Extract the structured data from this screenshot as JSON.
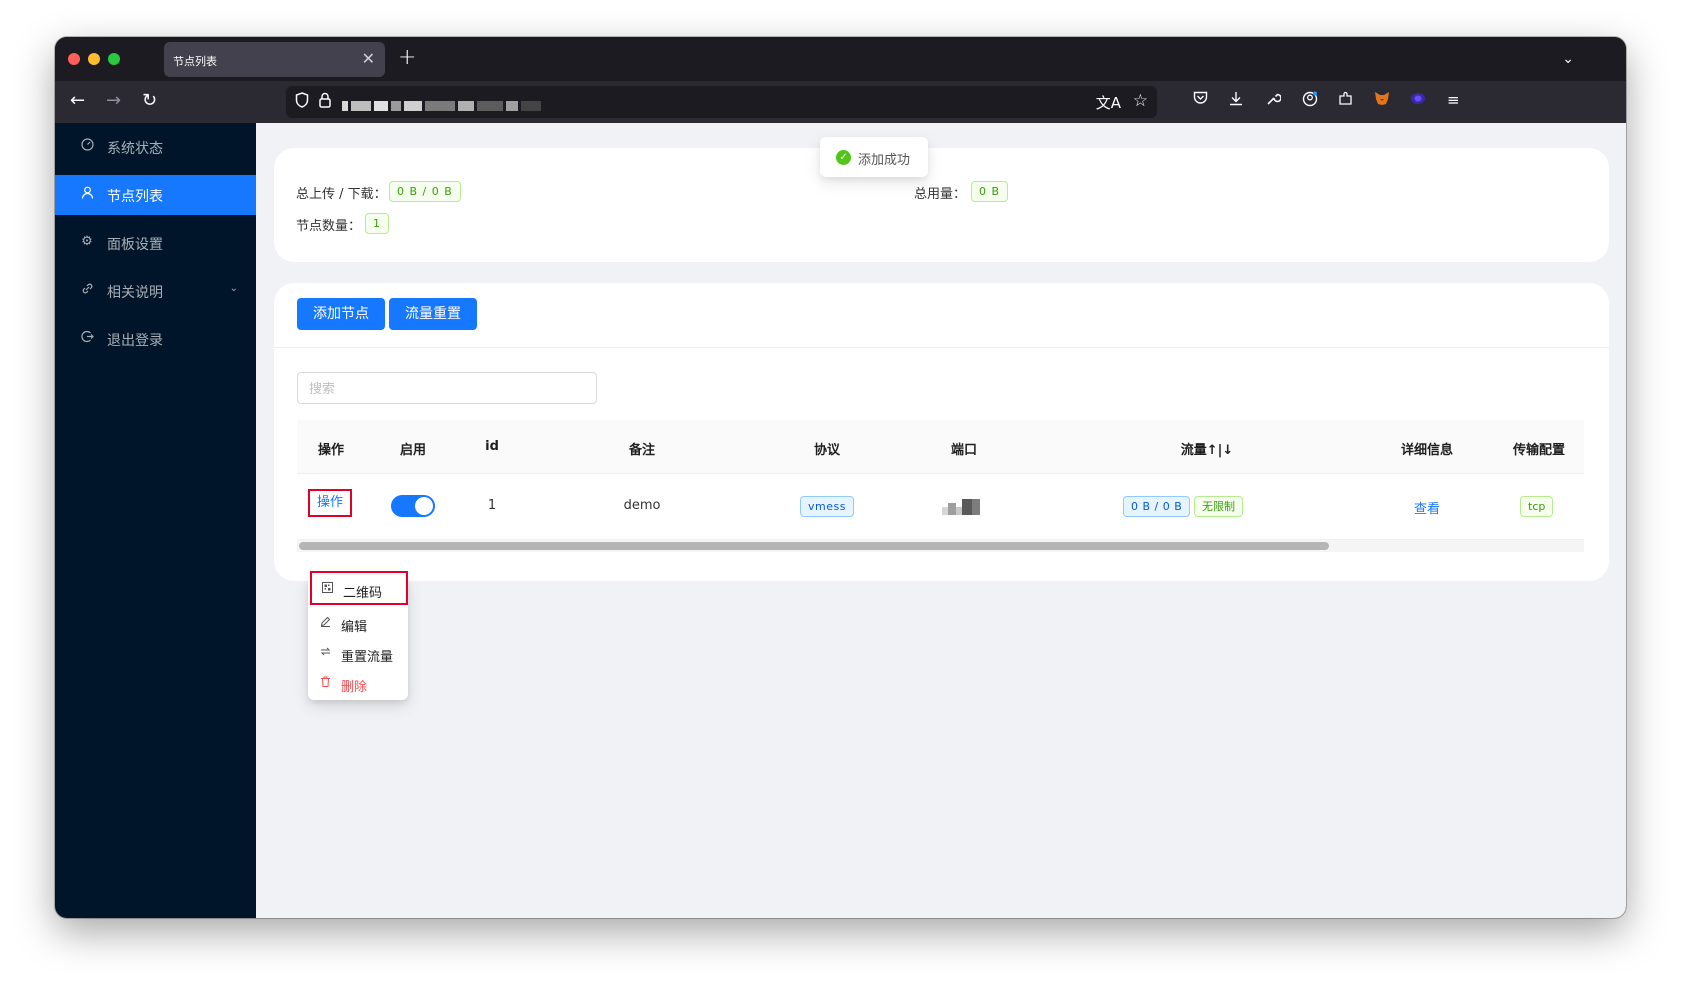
{
  "browser": {
    "tab_title": "节点列表",
    "close_glyph": "✕",
    "new_tab_glyph": "+"
  },
  "sidebar": {
    "items": [
      {
        "label": "系统状态",
        "icon": "dashboard-icon"
      },
      {
        "label": "节点列表",
        "icon": "user-icon",
        "active": true
      },
      {
        "label": "面板设置",
        "icon": "gear-icon"
      },
      {
        "label": "相关说明",
        "icon": "link-icon",
        "has_submenu": true
      },
      {
        "label": "退出登录",
        "icon": "logout-icon"
      }
    ]
  },
  "stats": {
    "upload_download_label": "总上传 / 下载：",
    "upload_download_value": "0 B / 0 B",
    "total_usage_label": "总用量：",
    "total_usage_value": "0 B",
    "node_count_label": "节点数量：",
    "node_count_value": "1"
  },
  "toolbar": {
    "add_node_label": "添加节点",
    "reset_traffic_label": "流量重置"
  },
  "search": {
    "placeholder": "搜索"
  },
  "table": {
    "columns": [
      "操作",
      "启用",
      "id",
      "备注",
      "协议",
      "端口",
      "流量↑|↓",
      "详细信息",
      "传输配置"
    ],
    "rows": [
      {
        "action": "操作",
        "enabled": true,
        "id": "1",
        "remark": "demo",
        "protocol": "vmess",
        "traffic": "0 B / 0 B",
        "limit": "无限制",
        "details": "查看",
        "transport": "tcp"
      }
    ]
  },
  "dropdown": {
    "items": [
      {
        "label": "二维码",
        "icon": "qrcode-icon"
      },
      {
        "label": "编辑",
        "icon": "edit-icon"
      },
      {
        "label": "重置流量",
        "icon": "reset-icon"
      },
      {
        "label": "删除",
        "icon": "delete-icon"
      }
    ]
  },
  "toast": {
    "message": "添加成功"
  },
  "colors": {
    "primary": "#1677ff",
    "sidebar_bg": "#001529",
    "highlight_border": "#e0002a",
    "success": "#52c41a"
  }
}
